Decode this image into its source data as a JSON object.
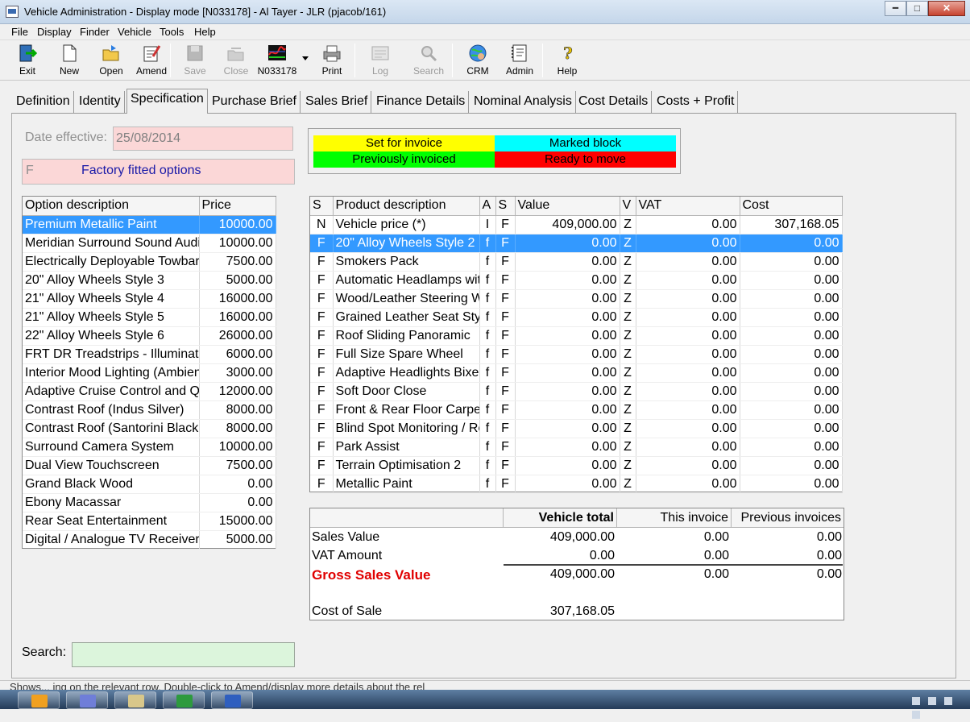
{
  "window": {
    "title": "Vehicle Administration - Display mode [N033178] - Al Tayer - JLR (pjacob/161)"
  },
  "menu": [
    "File",
    "Display",
    "Finder",
    "Vehicle",
    "Tools",
    "Help"
  ],
  "toolbar": {
    "exit": "Exit",
    "new": "New",
    "open": "Open",
    "amend": "Amend",
    "save": "Save",
    "close": "Close",
    "vehicle_ref": "N033178",
    "print": "Print",
    "log": "Log",
    "search": "Search",
    "crm": "CRM",
    "admin": "Admin",
    "help": "Help"
  },
  "tabs": [
    "Definition",
    "Identity",
    "Specification",
    "Purchase Brief",
    "Sales Brief",
    "Finance Details",
    "Nominal Analysis",
    "Cost Details",
    "Costs + Profit"
  ],
  "active_tab": "Specification",
  "date_effective": {
    "label": "Date effective:",
    "value": "25/08/2014"
  },
  "option_type": {
    "code": "F",
    "label": "Factory fitted options"
  },
  "legend": {
    "set_for_invoice": "Set for invoice",
    "marked_block": "Marked block",
    "previously_invoiced": "Previously invoiced",
    "ready_to_move": "Ready to move",
    "colors": {
      "yellow": "#ffff00",
      "cyan": "#00ffff",
      "green": "#00ff00",
      "red": "#ff0000"
    }
  },
  "options": {
    "headers": [
      "Option description",
      "Price"
    ],
    "rows": [
      [
        "Premium Metallic Paint",
        "10000.00"
      ],
      [
        "Meridian Surround Sound Audi",
        "10000.00"
      ],
      [
        "Electrically Deployable Towbar",
        "7500.00"
      ],
      [
        "20\" Alloy Wheels Style 3",
        "5000.00"
      ],
      [
        "21\" Alloy Wheels Style 4",
        "16000.00"
      ],
      [
        "21\" Alloy Wheels Style 5",
        "16000.00"
      ],
      [
        "22\" Alloy Wheels Style 6",
        "26000.00"
      ],
      [
        "FRT DR Treadstrips - Illuminat",
        "6000.00"
      ],
      [
        "Interior Mood Lighting (Ambien",
        "3000.00"
      ],
      [
        "Adaptive Cruise Control and Qu",
        "12000.00"
      ],
      [
        "Contrast Roof (Indus Silver)",
        "8000.00"
      ],
      [
        "Contrast Roof (Santorini Black",
        "8000.00"
      ],
      [
        "Surround Camera System",
        "10000.00"
      ],
      [
        "Dual View Touchscreen",
        "7500.00"
      ],
      [
        "Grand Black Wood",
        "0.00"
      ],
      [
        "Ebony Macassar",
        "0.00"
      ],
      [
        "Rear Seat Entertainment",
        "15000.00"
      ],
      [
        "Digital / Analogue TV Receiver",
        "5000.00"
      ]
    ]
  },
  "products": {
    "headers": [
      "S",
      "Product description",
      "A",
      "S",
      "Value",
      "V",
      "VAT",
      "Cost"
    ],
    "rows": [
      [
        "N",
        "Vehicle price (*)",
        "I",
        "F",
        "409,000.00",
        "Z",
        "0.00",
        "307,168.05"
      ],
      [
        "F",
        "20\" Alloy Wheels Style 2",
        "f",
        "F",
        "0.00",
        "Z",
        "0.00",
        "0.00"
      ],
      [
        "F",
        "Smokers Pack",
        "f",
        "F",
        "0.00",
        "Z",
        "0.00",
        "0.00"
      ],
      [
        "F",
        "Automatic Headlamps wit",
        "f",
        "F",
        "0.00",
        "Z",
        "0.00",
        "0.00"
      ],
      [
        "F",
        "Wood/Leather Steering W",
        "f",
        "F",
        "0.00",
        "Z",
        "0.00",
        "0.00"
      ],
      [
        "F",
        "Grained Leather Seat Sty",
        "f",
        "F",
        "0.00",
        "Z",
        "0.00",
        "0.00"
      ],
      [
        "F",
        "Roof Sliding Panoramic",
        "f",
        "F",
        "0.00",
        "Z",
        "0.00",
        "0.00"
      ],
      [
        "F",
        "Full Size Spare Wheel",
        "f",
        "F",
        "0.00",
        "Z",
        "0.00",
        "0.00"
      ],
      [
        "F",
        "Adaptive Headlights Bixer",
        "f",
        "F",
        "0.00",
        "Z",
        "0.00",
        "0.00"
      ],
      [
        "F",
        "Soft Door Close",
        "f",
        "F",
        "0.00",
        "Z",
        "0.00",
        "0.00"
      ],
      [
        "F",
        "Front & Rear Floor Carpe",
        "f",
        "F",
        "0.00",
        "Z",
        "0.00",
        "0.00"
      ],
      [
        "F",
        "Blind Spot Monitoring / Re",
        "f",
        "F",
        "0.00",
        "Z",
        "0.00",
        "0.00"
      ],
      [
        "F",
        "Park Assist",
        "f",
        "F",
        "0.00",
        "Z",
        "0.00",
        "0.00"
      ],
      [
        "F",
        "Terrain Optimisation 2",
        "f",
        "F",
        "0.00",
        "Z",
        "0.00",
        "0.00"
      ],
      [
        "F",
        "Metallic Paint",
        "f",
        "F",
        "0.00",
        "Z",
        "0.00",
        "0.00"
      ]
    ]
  },
  "totals": {
    "headers": {
      "vehicle_total": "Vehicle total",
      "this_invoice": "This invoice",
      "previous_invoices": "Previous invoices"
    },
    "sales_value": {
      "label": "Sales Value",
      "vehicle_total": "409,000.00",
      "this_invoice": "0.00",
      "previous": "0.00"
    },
    "vat_amount": {
      "label": "VAT Amount",
      "vehicle_total": "0.00",
      "this_invoice": "0.00",
      "previous": "0.00"
    },
    "gross_sales_value": {
      "label": "Gross Sales Value",
      "vehicle_total": "409,000.00",
      "this_invoice": "0.00",
      "previous": "0.00",
      "color": "#e00000"
    },
    "cost_of_sale": {
      "label": "Cost of Sale",
      "vehicle_total": "307,168.05"
    }
  },
  "search": {
    "label": "Search:",
    "value": ""
  },
  "status": {
    "text": "Shows... ing on the relevant row. Double-click to Amend/display more details about the rel"
  }
}
